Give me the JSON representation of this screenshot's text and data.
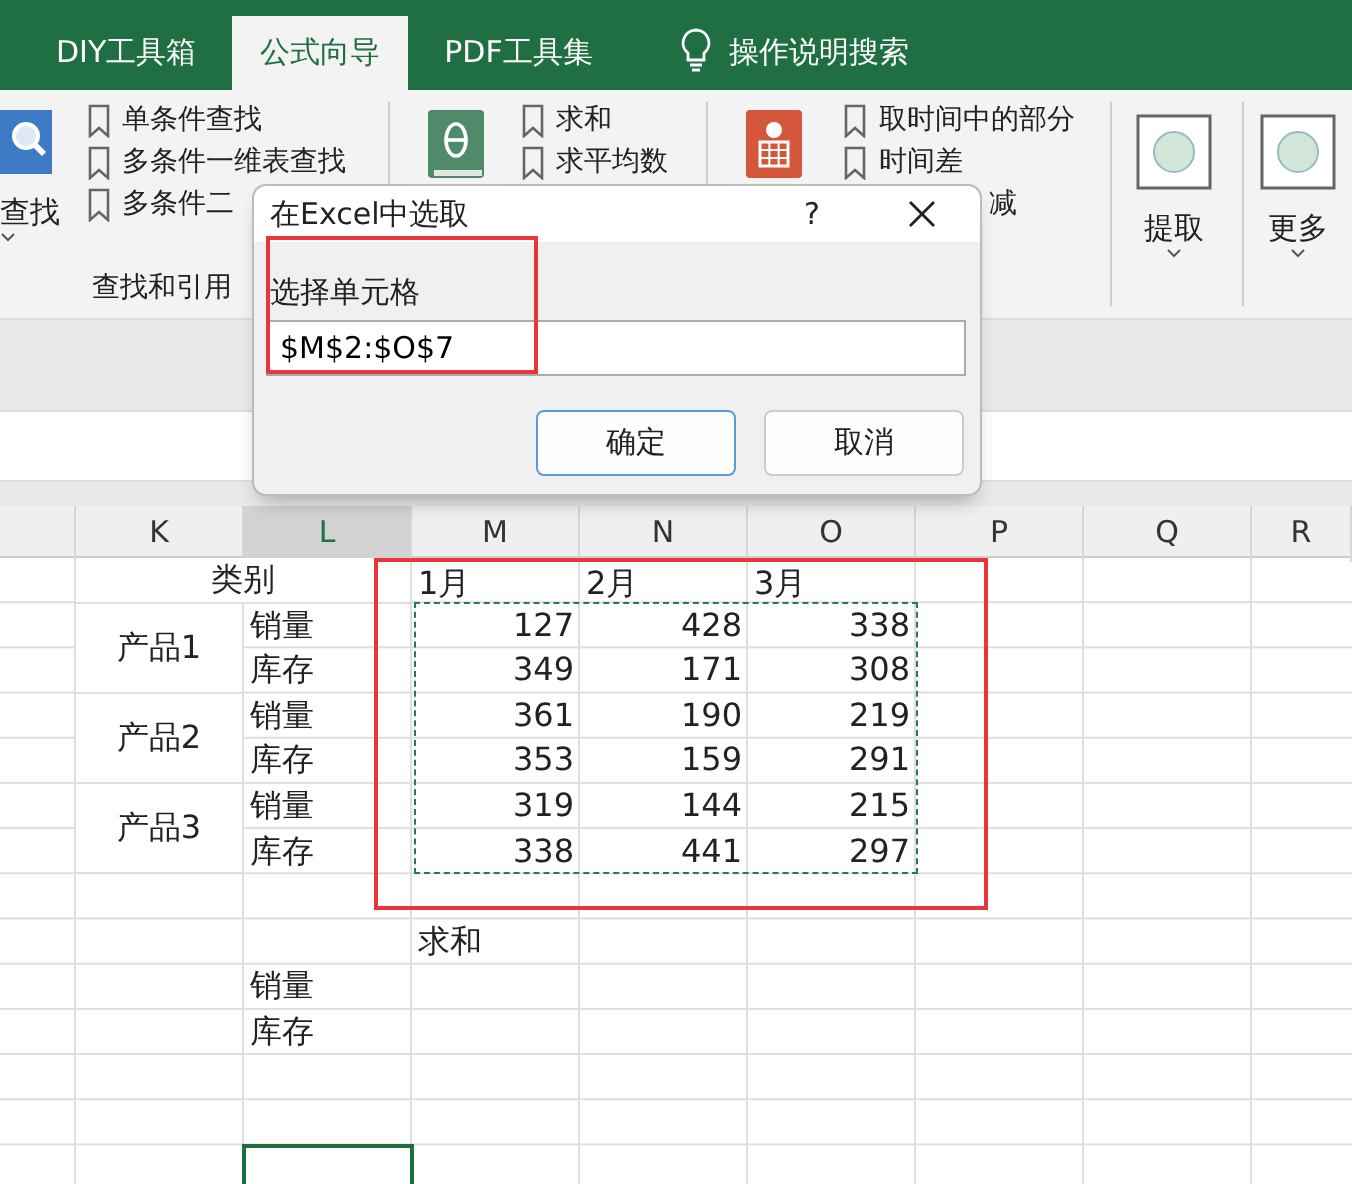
{
  "tabs": [
    {
      "label": "DIY工具箱",
      "selected": false
    },
    {
      "label": "公式向导",
      "selected": true
    },
    {
      "label": "PDF工具集",
      "selected": false
    }
  ],
  "search_hint": "操作说明搜索",
  "ribbon": [
    {
      "kind": "list",
      "big_label": "查找",
      "items": [
        "单条件查找",
        "多条件一维表查找",
        "多条件二"
      ],
      "label": "查找和引用"
    },
    {
      "kind": "list",
      "items": [
        "求和",
        "求平均数"
      ]
    },
    {
      "kind": "list",
      "items": [
        "取时间中的部分",
        "时间差",
        "减"
      ]
    },
    {
      "kind": "button",
      "label": "提取"
    },
    {
      "kind": "button",
      "label": "更多"
    }
  ],
  "dialog": {
    "title": "在Excel中选取",
    "help": "?",
    "field_label": "选择单元格",
    "value": "$M$2:$O$7",
    "buttons": [
      {
        "label": "确定",
        "selected": true
      },
      {
        "label": "取消",
        "selected": false
      }
    ]
  },
  "sheet": {
    "columns": [
      {
        "label": "K",
        "selected": false
      },
      {
        "label": "L",
        "selected": true
      },
      {
        "label": "M",
        "selected": false
      },
      {
        "label": "N",
        "selected": false
      },
      {
        "label": "O",
        "selected": false
      },
      {
        "label": "P",
        "selected": false
      },
      {
        "label": "Q",
        "selected": false
      },
      {
        "label": "R",
        "selected": false
      }
    ],
    "category": "类别",
    "months": [
      "1月",
      "2月",
      "3月"
    ],
    "products": [
      {
        "name": "产品1",
        "rows": [
          {
            "metric": "销量",
            "values": [
              "127",
              "428",
              "338"
            ]
          },
          {
            "metric": "库存",
            "values": [
              "349",
              "171",
              "308"
            ]
          }
        ]
      },
      {
        "name": "产品2",
        "rows": [
          {
            "metric": "销量",
            "values": [
              "361",
              "190",
              "219"
            ]
          },
          {
            "metric": "库存",
            "values": [
              "353",
              "159",
              "291"
            ]
          }
        ]
      },
      {
        "name": "产品3",
        "rows": [
          {
            "metric": "销量",
            "values": [
              "319",
              "144",
              "215"
            ]
          },
          {
            "metric": "库存",
            "values": [
              "338",
              "441",
              "297"
            ]
          }
        ]
      }
    ],
    "sum_label": "求和",
    "sum_rows": [
      "销量",
      "库存"
    ]
  }
}
